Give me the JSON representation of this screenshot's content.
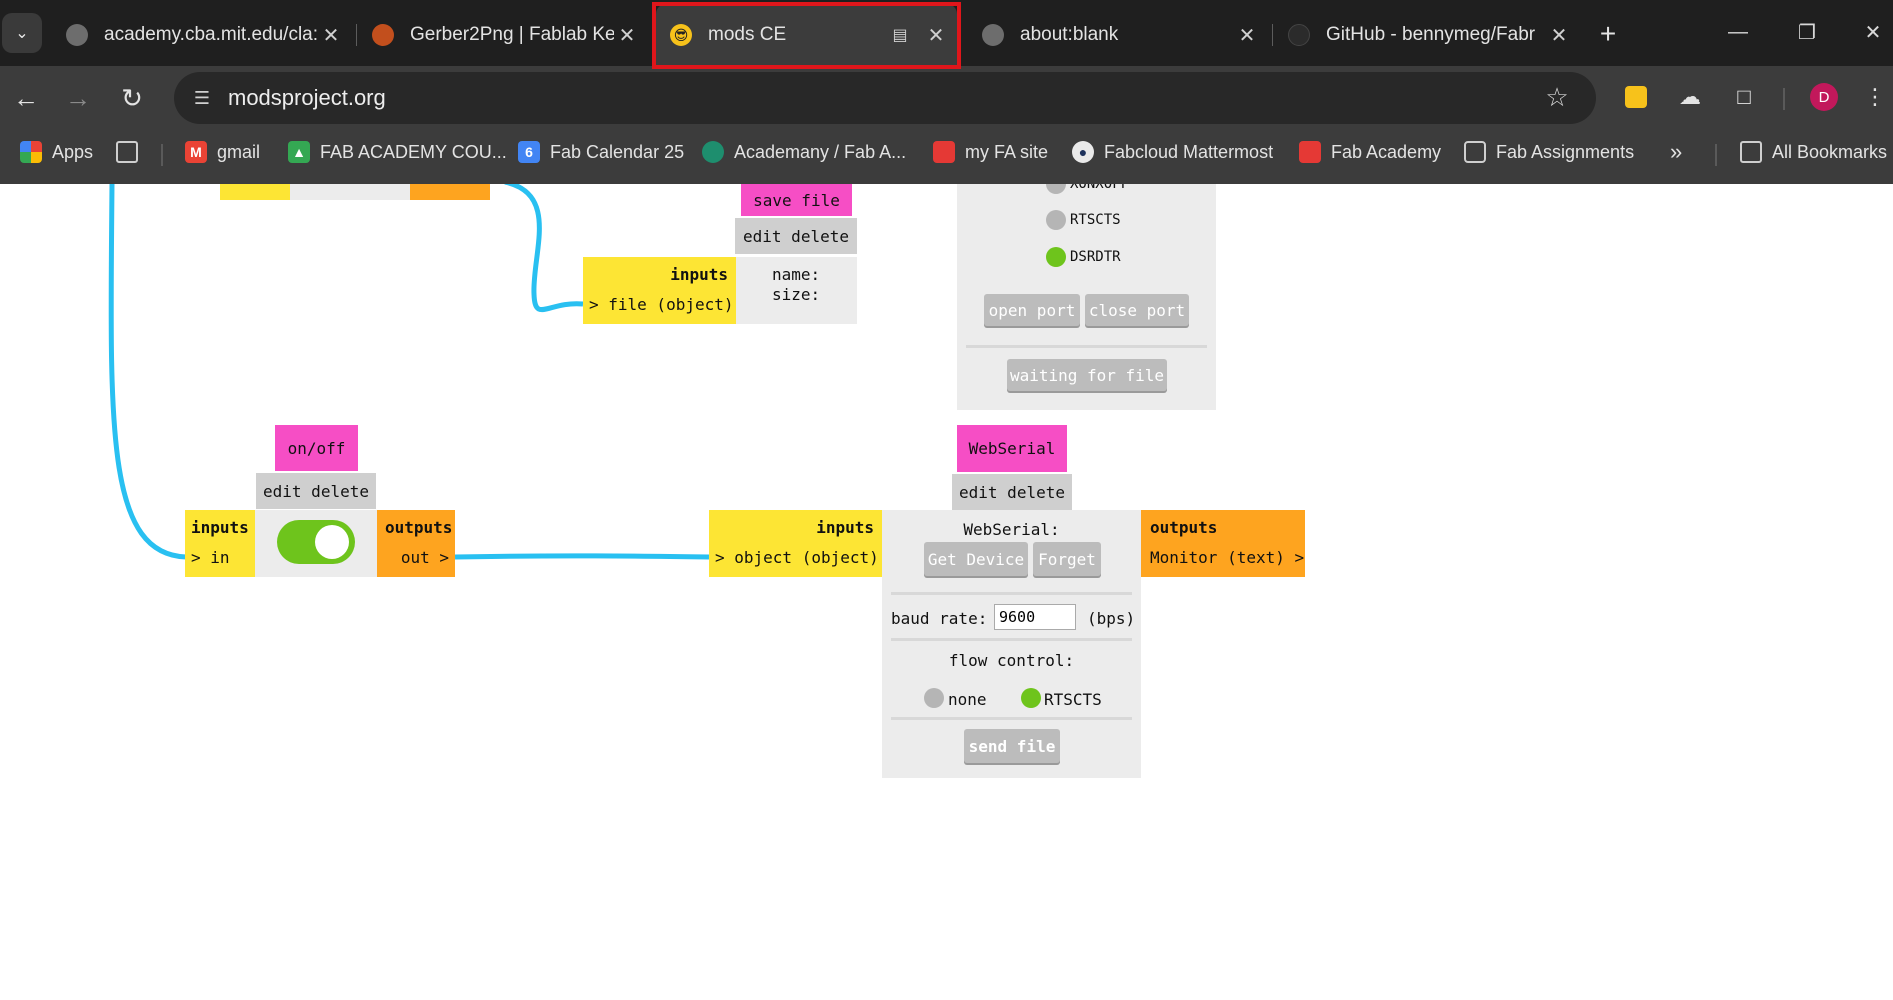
{
  "browser": {
    "tabs": [
      {
        "title": "academy.cba.mit.edu/cla:",
        "active": false
      },
      {
        "title": "Gerber2Png | Fablab Kera",
        "active": false
      },
      {
        "title": "mods CE",
        "active": true
      },
      {
        "title": "about:blank",
        "active": false
      },
      {
        "title": "GitHub - bennymeg/Fabr",
        "active": false
      }
    ],
    "url": "modsproject.org",
    "profile_initial": "D",
    "bookmarks": [
      {
        "label": "Apps"
      },
      {
        "label": "gmail"
      },
      {
        "label": "FAB ACADEMY COU..."
      },
      {
        "label": "Fab Calendar 25"
      },
      {
        "label": "Academany / Fab A..."
      },
      {
        "label": "my FA site"
      },
      {
        "label": "Fabcloud Mattermost"
      },
      {
        "label": "Fab Academy"
      },
      {
        "label": "Fab Assignments"
      }
    ],
    "all_bookmarks": "All Bookmarks",
    "more_bookmarks": "»"
  },
  "mods": {
    "save_file": {
      "title": "save file",
      "edit_delete": "edit delete",
      "inputs_label": "inputs",
      "input_port": "> file (object)",
      "name_label": "name:",
      "size_label": "size:"
    },
    "serial_panel": {
      "options": [
        {
          "label": "XONXOFF",
          "selected": false
        },
        {
          "label": "RTSCTS",
          "selected": false
        },
        {
          "label": "DSRDTR",
          "selected": true
        }
      ],
      "open_port": "open port",
      "close_port": "close port",
      "waiting": "waiting for file"
    },
    "onoff": {
      "title": "on/off",
      "edit_delete": "edit delete",
      "inputs_label": "inputs",
      "input_port": "> in",
      "outputs_label": "outputs",
      "output_port": "out >",
      "toggle_on": true
    },
    "webserial": {
      "title": "WebSerial",
      "edit_delete": "edit delete",
      "inputs_label": "inputs",
      "input_port": "> object (object)",
      "outputs_label": "outputs",
      "output_port": "Monitor (text) >",
      "heading": "WebSerial:",
      "get_device": "Get Device",
      "forget": "Forget",
      "baud_label": "baud rate:",
      "baud_value": "9600",
      "baud_unit": "(bps)",
      "flow_label": "flow control:",
      "flow_options": [
        {
          "label": "none",
          "selected": false
        },
        {
          "label": "RTSCTS",
          "selected": true
        }
      ],
      "send_file": "send file"
    }
  },
  "colors": {
    "wire": "#29c0f1",
    "module_title": "#f64ec5",
    "inputs": "#fde534",
    "outputs": "#fea41f",
    "toggle": "#6ec41c"
  }
}
